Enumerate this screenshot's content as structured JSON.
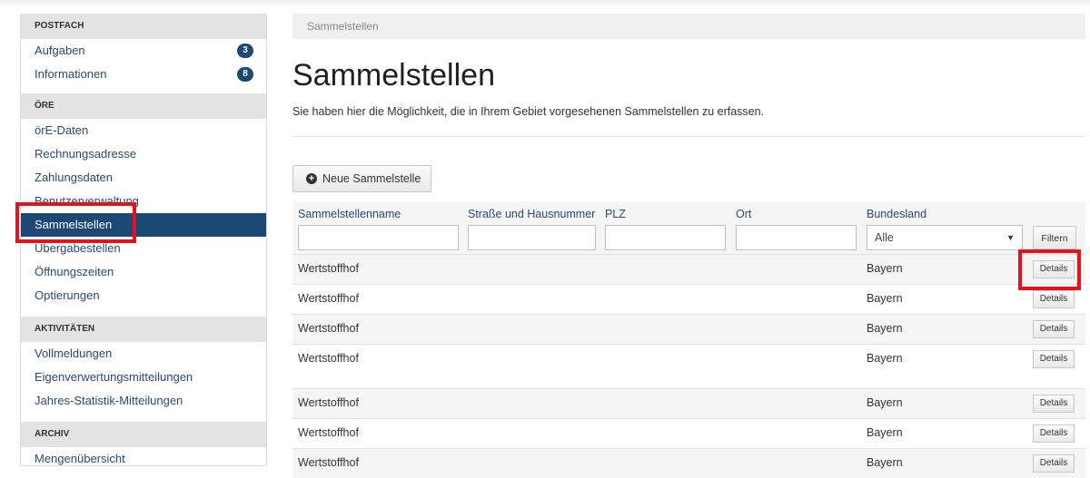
{
  "sidebar": {
    "postfach": {
      "title": "POSTFACH",
      "items": [
        {
          "label": "Aufgaben",
          "badge": "3"
        },
        {
          "label": "Informationen",
          "badge": "8"
        }
      ]
    },
    "ore": {
      "title": "ÖRE",
      "items": [
        {
          "label": "örE-Daten"
        },
        {
          "label": "Rechnungsadresse"
        },
        {
          "label": "Zahlungsdaten"
        },
        {
          "label": "Benutzerverwaltung"
        },
        {
          "label": "Sammelstellen"
        },
        {
          "label": "Übergabestellen"
        },
        {
          "label": "Öffnungszeiten"
        },
        {
          "label": "Optierungen"
        }
      ]
    },
    "aktivitaeten": {
      "title": "AKTIVITÄTEN",
      "items": [
        {
          "label": "Vollmeldungen"
        },
        {
          "label": "Eigenverwertungsmitteilungen"
        },
        {
          "label": "Jahres-Statistik-Mitteilungen"
        }
      ]
    },
    "archiv": {
      "title": "ARCHIV",
      "items": [
        {
          "label": "Mengenübersicht"
        }
      ]
    }
  },
  "breadcrumb": "Sammelstellen",
  "page": {
    "title": "Sammelstellen",
    "description": "Sie haben hier die Möglichkeit, die in Ihrem Gebiet vorgesehenen Sammelstellen zu erfassen.",
    "new_button": "Neue Sammelstelle"
  },
  "table": {
    "columns": [
      "Sammelstellenname",
      "Straße und Hausnummer",
      "PLZ",
      "Ort",
      "Bundesland"
    ],
    "bundesland_select": "Alle",
    "filter_button": "Filtern",
    "details_label": "Details",
    "rows": [
      {
        "name": "Wertstoffhof",
        "bundesland": "Bayern"
      },
      {
        "name": "Wertstoffhof",
        "bundesland": "Bayern"
      },
      {
        "name": "Wertstoffhof",
        "bundesland": "Bayern"
      },
      {
        "name": "Wertstoffhof",
        "bundesland": "Bayern"
      },
      {
        "name": "Wertstoffhof",
        "bundesland": "Bayern"
      },
      {
        "name": "Wertstoffhof",
        "bundesland": "Bayern"
      },
      {
        "name": "Wertstoffhof",
        "bundesland": "Bayern"
      }
    ]
  },
  "colors": {
    "accent": "#1c4876",
    "highlight": "#e3131e"
  }
}
